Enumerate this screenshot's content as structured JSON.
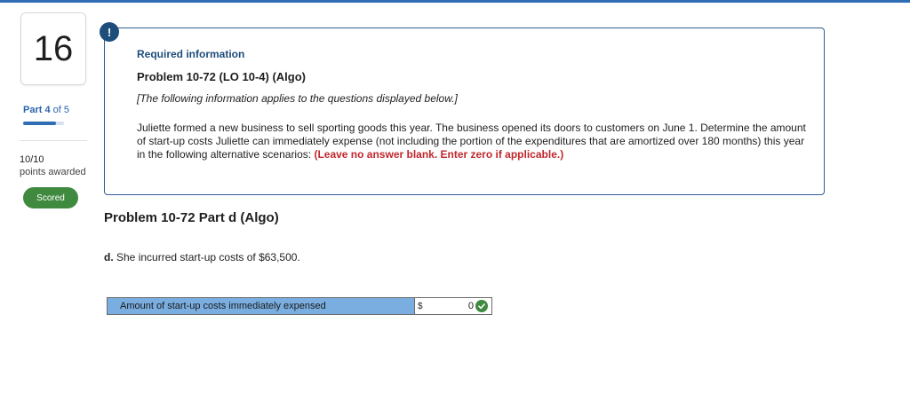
{
  "question": {
    "number": "16",
    "part_word": "Part 4",
    "part_of": " of 5",
    "progress_fraction": 0.8,
    "points_value": "10/10",
    "points_label": "points awarded",
    "status_badge": "Scored"
  },
  "info": {
    "alert_glyph": "!",
    "heading": "Required information",
    "problem_title": "Problem 10-72 (LO 10-4) (Algo)",
    "applies_note": "[The following information applies to the questions displayed below.]",
    "scenario_text": "Juliette formed a new business to sell sporting goods this year. The business opened its doors to customers on June 1. Determine the amount of start-up costs Juliette can immediately expense (not including the portion of the expenditures that are amortized over 180 months) this year in the following alternative scenarios: ",
    "scenario_emphasis": "(Leave no answer blank. Enter zero if applicable.)"
  },
  "part": {
    "heading": "Problem 10-72 Part d (Algo)",
    "question_letter": "d.",
    "question_text": " She incurred start-up costs of $63,500."
  },
  "answer": {
    "label": "Amount of start-up costs immediately expensed",
    "currency": "$",
    "value": "0",
    "status": "correct"
  },
  "colors": {
    "accent": "#2f6db5",
    "info_heading": "#1e4d7b",
    "emphasis": "#c0272d",
    "badge": "#3f8a3f",
    "answer_label_bg": "#7aaee0"
  },
  "icons": {
    "alert": "alert-icon",
    "check": "check-icon"
  }
}
